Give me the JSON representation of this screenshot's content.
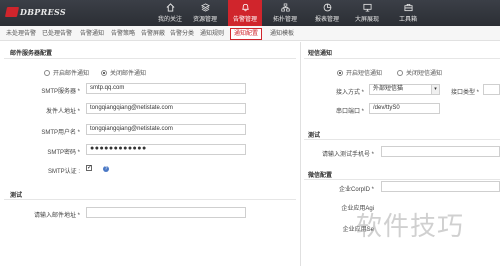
{
  "brand": {
    "logo_text": "DBPRESS"
  },
  "nav": {
    "items": [
      {
        "label": "我的关注",
        "icon": "home-icon"
      },
      {
        "label": "资源管理",
        "icon": "layers-icon"
      },
      {
        "label": "告警管理",
        "icon": "bell-icon",
        "active": true
      },
      {
        "label": "拓扑管理",
        "icon": "topology-icon"
      },
      {
        "label": "报表管理",
        "icon": "report-icon"
      },
      {
        "label": "大屏展现",
        "icon": "screen-icon"
      },
      {
        "label": "工具箱",
        "icon": "toolbox-icon"
      }
    ],
    "accent": "#d0252c"
  },
  "tabs": [
    {
      "label": "未处理告警"
    },
    {
      "label": "已处理告警"
    },
    {
      "label": "告警通知"
    },
    {
      "label": "告警策略"
    },
    {
      "label": "告警屏蔽"
    },
    {
      "label": "告警分类"
    },
    {
      "label": "通知规则"
    },
    {
      "label": "通知配置",
      "active": true
    },
    {
      "label": "通知模板"
    }
  ],
  "mail": {
    "title": "邮件服务器配置",
    "radio_on": "开启邮件通知",
    "radio_off": "关闭邮件通知",
    "smtp_server_label": "SMTP服务器 *",
    "smtp_server_value": "smtp.qq.com",
    "sender_label": "发件人地址 *",
    "sender_value": "tongqiangqiang@netistate.com",
    "smtp_user_label": "SMTP用户名 *",
    "smtp_user_value": "tongqiangqiang@netistate.com",
    "smtp_pwd_label": "SMTP密码 *",
    "smtp_pwd_value": "●●●●●●●●●●●●",
    "smtp_auth_label": "SMTP认证 :",
    "smtp_auth_checked": "✓",
    "help_glyph": "?"
  },
  "mail_test": {
    "title": "测试",
    "email_label": "请输入邮件地址 *"
  },
  "sms": {
    "title": "短信通知",
    "radio_on": "开启短信通知",
    "radio_off": "关闭短信通知",
    "access_label": "接入方式 *",
    "access_value": "外部短信猫",
    "port_label": "接口类型 *",
    "port_value": "",
    "serial_label": "串口端口 *",
    "serial_value": "/dev/ttyS0"
  },
  "sms_test": {
    "title": "测试",
    "phone_label": "请输入测试手机号 *"
  },
  "wechat": {
    "title": "微信配置",
    "corp_label": "企业CorpID *",
    "app_label": "企业应用Agi",
    "secret_label": "企业应用Se"
  },
  "watermark": "软件技巧"
}
